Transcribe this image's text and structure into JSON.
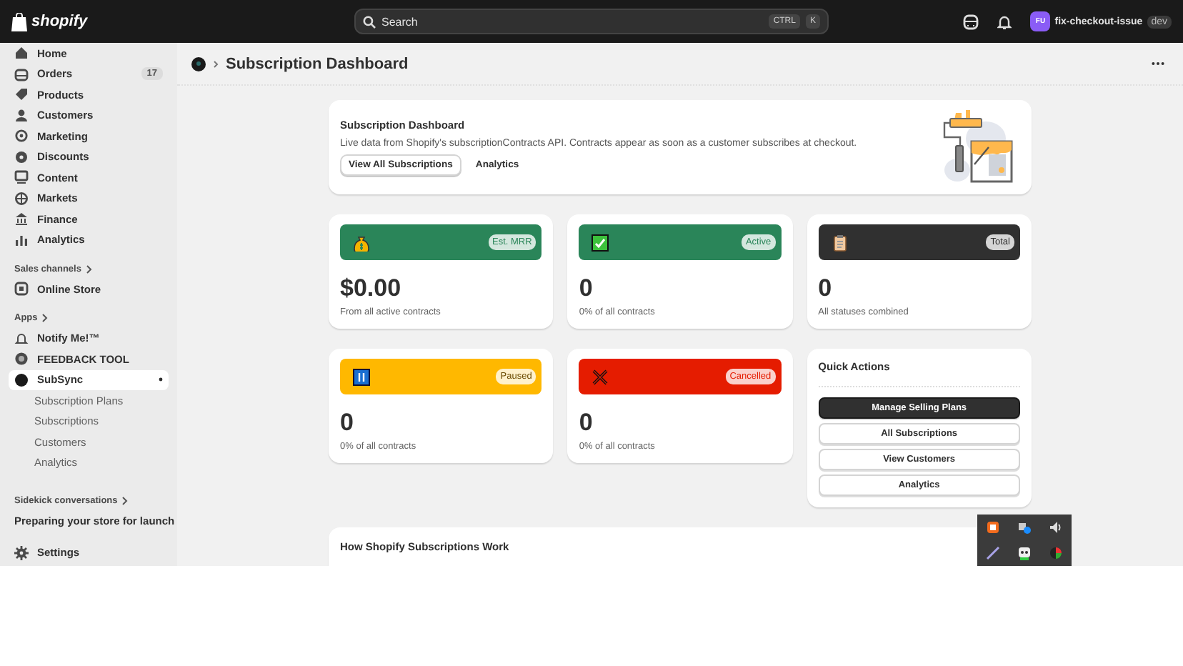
{
  "topbar": {
    "logo": "shopify",
    "search": {
      "placeholder": "Search",
      "keys": [
        "CTRL",
        "K"
      ]
    },
    "store": {
      "initials": "FU",
      "name": "fix-checkout-issue",
      "badge": "dev"
    }
  },
  "sidebar": {
    "items": [
      {
        "label": "Home"
      },
      {
        "label": "Orders",
        "count": "17"
      },
      {
        "label": "Products"
      },
      {
        "label": "Customers"
      },
      {
        "label": "Marketing"
      },
      {
        "label": "Discounts"
      },
      {
        "label": "Content"
      },
      {
        "label": "Markets"
      },
      {
        "label": "Finance"
      },
      {
        "label": "Analytics"
      }
    ],
    "sales_channels": {
      "heading": "Sales channels",
      "items": [
        {
          "label": "Online Store"
        }
      ]
    },
    "apps": {
      "heading": "Apps",
      "items": [
        {
          "label": "Notify Me!™",
          "selected": false
        },
        {
          "label": "FEEDBACK TOOL",
          "selected": false
        },
        {
          "label": "SubSync",
          "selected": true,
          "children": [
            {
              "label": "Subscription Plans"
            },
            {
              "label": "Subscriptions"
            },
            {
              "label": "Customers"
            },
            {
              "label": "Analytics"
            }
          ]
        }
      ]
    },
    "sidekick": {
      "heading": "Sidekick conversations",
      "items": [
        "Preparing your store for launch"
      ]
    },
    "settings": "Settings"
  },
  "page": {
    "title": "Subscription Dashboard",
    "hero": {
      "title": "Subscription Dashboard",
      "text": "Live data from Shopify's subscriptionContracts API. Contracts appear as soon as a customer subscribes at checkout.",
      "buttons": [
        {
          "label": "View All Subscriptions",
          "kind": "outlined"
        },
        {
          "label": "Analytics",
          "kind": "plain"
        }
      ]
    },
    "stats": [
      {
        "kind": "money",
        "color": "#2a8559",
        "badge": "Est. MRR",
        "value": "$0.00",
        "caption": "From all active contracts"
      },
      {
        "kind": "check",
        "color": "#2a8559",
        "badge": "Active",
        "value": "0",
        "caption": "0% of all contracts"
      },
      {
        "kind": "clipboard",
        "color": "#303030",
        "badge": "Total",
        "value": "0",
        "caption": "All statuses combined"
      },
      {
        "kind": "pause",
        "color": "#ffb800",
        "badge": "Paused",
        "value": "0",
        "caption": "0% of all contracts"
      },
      {
        "kind": "cross",
        "color": "#e51c00",
        "badge": "Cancelled",
        "value": "0",
        "caption": "0% of all contracts"
      }
    ],
    "quick_actions": {
      "title": "Quick Actions",
      "buttons": [
        {
          "label": "Manage Selling Plans",
          "primary": true
        },
        {
          "label": "All Subscriptions",
          "primary": false
        },
        {
          "label": "View Customers",
          "primary": false
        },
        {
          "label": "Analytics",
          "primary": false
        }
      ]
    },
    "section": {
      "title": "How Shopify Subscriptions Work"
    }
  }
}
